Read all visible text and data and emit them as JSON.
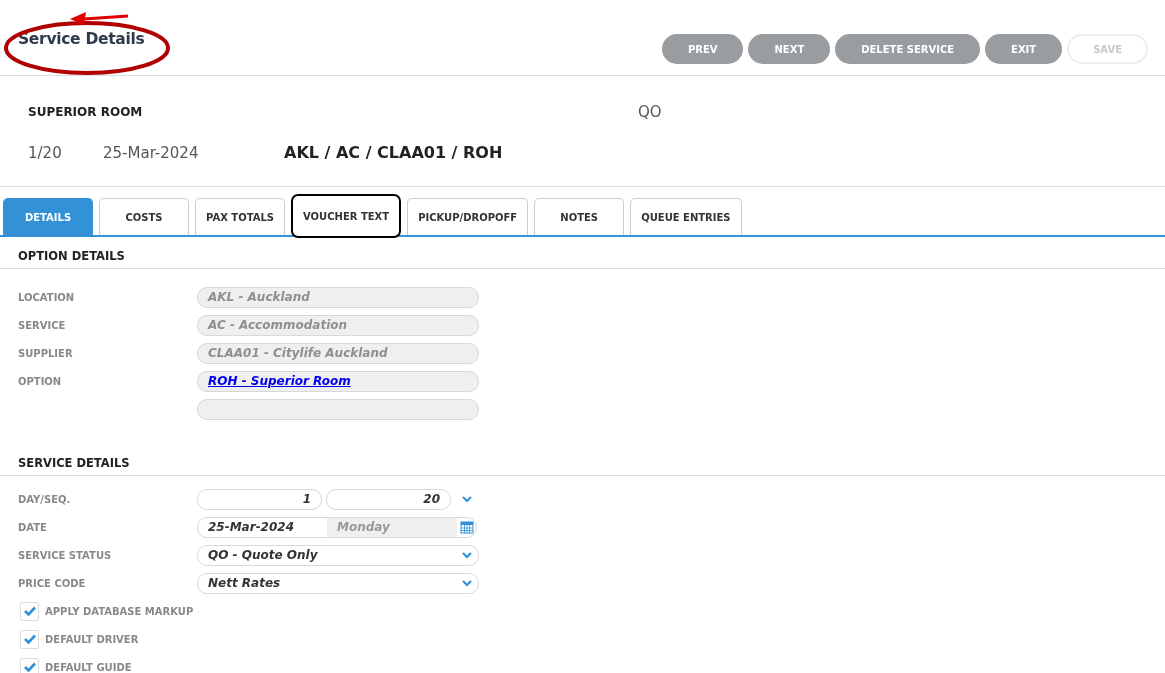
{
  "header": {
    "title": "Service Details",
    "title_circled": true,
    "buttons": [
      {
        "label": "PREV",
        "disabled": false
      },
      {
        "label": "NEXT",
        "disabled": false
      },
      {
        "label": "DELETE SERVICE",
        "disabled": false
      },
      {
        "label": "EXIT",
        "disabled": false
      },
      {
        "label": "SAVE",
        "disabled": true
      }
    ]
  },
  "summary": {
    "name": "SUPERIOR ROOM",
    "status_code": "QO",
    "day_seq": "1/20",
    "date": "25-Mar-2024",
    "code_path": "AKL / AC / CLAA01 / ROH"
  },
  "tabs": [
    {
      "label": "DETAILS",
      "selected": true,
      "outlined": false
    },
    {
      "label": "COSTS",
      "selected": false,
      "outlined": false
    },
    {
      "label": "PAX TOTALS",
      "selected": false,
      "outlined": false
    },
    {
      "label": "VOUCHER TEXT",
      "selected": false,
      "outlined": true
    },
    {
      "label": "PICKUP/DROPOFF",
      "selected": false,
      "outlined": false
    },
    {
      "label": "NOTES",
      "selected": false,
      "outlined": false
    },
    {
      "label": "QUEUE ENTRIES",
      "selected": false,
      "outlined": false
    }
  ],
  "option_details": {
    "heading": "OPTION DETAILS",
    "fields": [
      {
        "kind": "readonly",
        "label": "LOCATION",
        "value": "AKL - Auckland"
      },
      {
        "kind": "readonly",
        "label": "SERVICE",
        "value": "AC - Accommodation"
      },
      {
        "kind": "readonly",
        "label": "SUPPLIER",
        "value": "CLAA01 - Citylife Auckland"
      },
      {
        "kind": "link",
        "label": "OPTION",
        "value": "ROH - Superior Room"
      },
      {
        "kind": "readonly"
      }
    ]
  },
  "service_details": {
    "heading": "SERVICE DETAILS",
    "fields": [
      {
        "kind": "day_seq",
        "label": "DAY/SEQ.",
        "day": "1",
        "seq": "20"
      },
      {
        "kind": "date",
        "label": "DATE",
        "value": "25-Mar-2024",
        "weekday": "Monday"
      },
      {
        "kind": "select",
        "label": "SERVICE STATUS",
        "value": "QO - Quote Only"
      },
      {
        "kind": "select",
        "label": "PRICE CODE",
        "value": "Nett Rates"
      }
    ],
    "checkboxes": [
      {
        "label": "APPLY DATABASE MARKUP",
        "checked": true
      },
      {
        "label": "DEFAULT DRIVER",
        "checked": true
      },
      {
        "label": "DEFAULT GUIDE",
        "checked": true
      }
    ]
  }
}
